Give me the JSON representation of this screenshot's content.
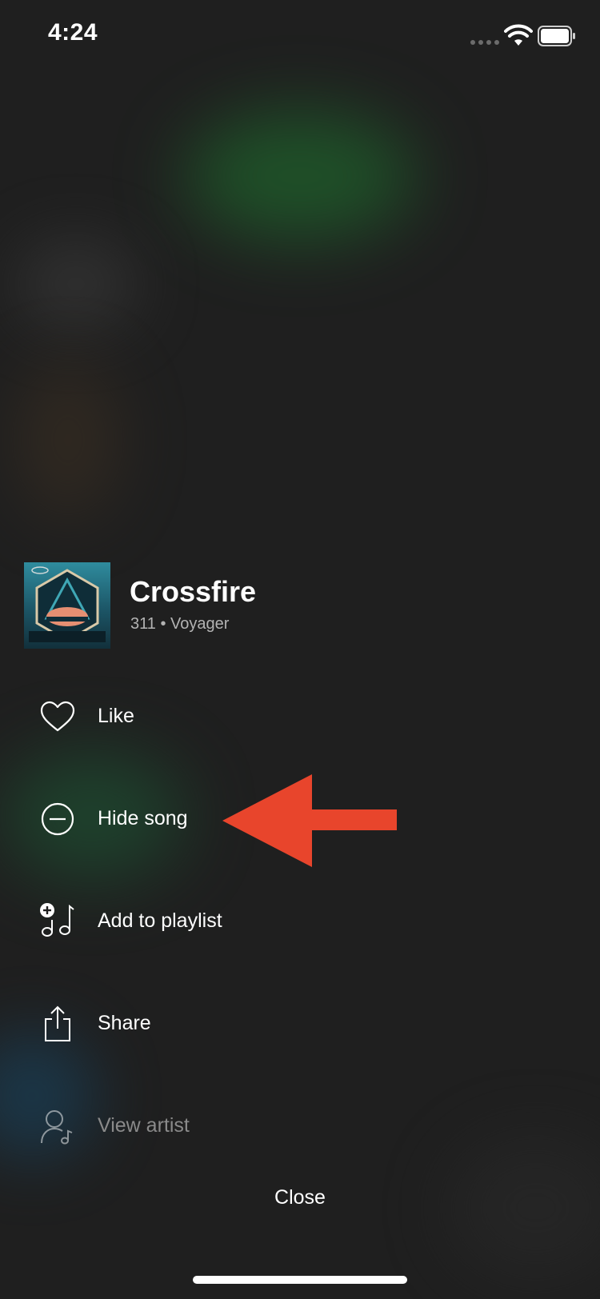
{
  "status_bar": {
    "time": "4:24",
    "icons": [
      "cellular-signal-icon",
      "wifi-icon",
      "battery-icon"
    ]
  },
  "track": {
    "title": "Crossfire",
    "subtitle": "311 • Voyager",
    "album_art_icon": "album-cover-icon"
  },
  "menu": {
    "items": [
      {
        "label": "Like",
        "icon": "heart-icon",
        "dimmed": false
      },
      {
        "label": "Hide song",
        "icon": "minus-circle-icon",
        "dimmed": false
      },
      {
        "label": "Add to playlist",
        "icon": "add-to-playlist-icon",
        "dimmed": false
      },
      {
        "label": "Share",
        "icon": "share-icon",
        "dimmed": false
      },
      {
        "label": "View artist",
        "icon": "artist-icon",
        "dimmed": true
      }
    ]
  },
  "annotation": {
    "icon": "red-arrow-icon",
    "color": "#e8452c"
  },
  "close_label": "Close",
  "colors": {
    "background": "#1f1f1f",
    "text_primary": "#ffffff",
    "text_secondary": "#b3b3b3",
    "arrow": "#e8452c"
  }
}
